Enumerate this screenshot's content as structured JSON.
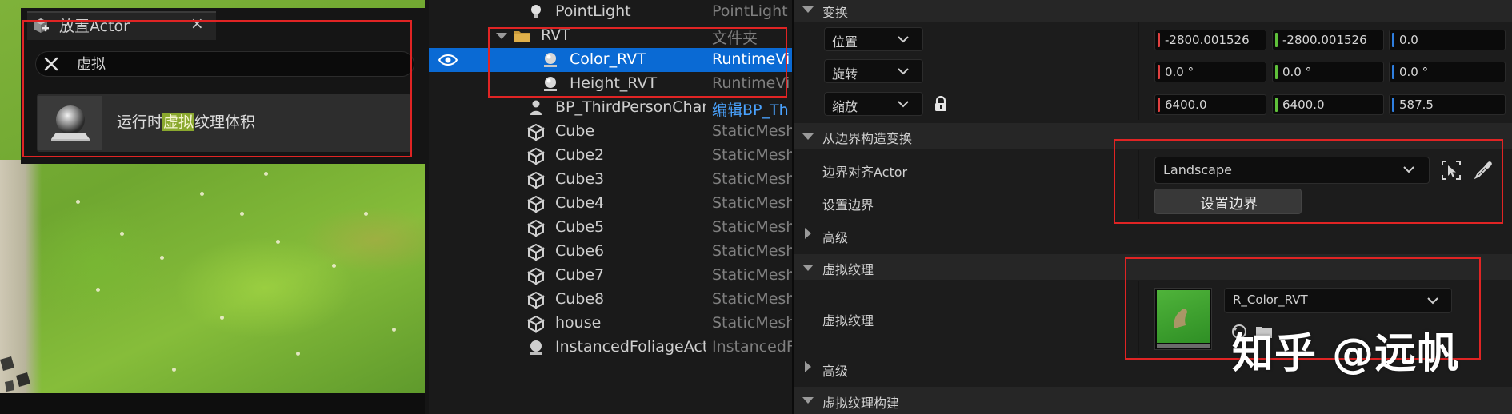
{
  "place_actor": {
    "tab_title": "放置Actor",
    "close_glyph": "×",
    "search_value": "虚拟",
    "result": {
      "pre": "运行时",
      "match": "虚拟",
      "post": "纹理体积"
    }
  },
  "outliner": {
    "rows": [
      {
        "name": "PointLight",
        "type": "PointLight",
        "icon": "point-light-icon"
      },
      {
        "name": "RVT",
        "type": "文件夹",
        "icon": "folder-icon"
      },
      {
        "name": "Color_RVT",
        "type": "RuntimeVi",
        "icon": "runtime-virtual-texture-icon",
        "selected": true
      },
      {
        "name": "Height_RVT",
        "type": "RuntimeVi",
        "icon": "runtime-virtual-texture-icon"
      },
      {
        "name": "BP_ThirdPersonChar",
        "type": "编辑BP_Th",
        "icon": "pawn-icon",
        "link": true
      },
      {
        "name": "Cube",
        "type": "StaticMesh",
        "icon": "static-mesh-icon"
      },
      {
        "name": "Cube2",
        "type": "StaticMesh",
        "icon": "static-mesh-icon"
      },
      {
        "name": "Cube3",
        "type": "StaticMesh",
        "icon": "static-mesh-icon"
      },
      {
        "name": "Cube4",
        "type": "StaticMesh",
        "icon": "static-mesh-icon"
      },
      {
        "name": "Cube5",
        "type": "StaticMesh",
        "icon": "static-mesh-icon"
      },
      {
        "name": "Cube6",
        "type": "StaticMesh",
        "icon": "static-mesh-icon"
      },
      {
        "name": "Cube7",
        "type": "StaticMesh",
        "icon": "static-mesh-icon"
      },
      {
        "name": "Cube8",
        "type": "StaticMesh",
        "icon": "static-mesh-icon"
      },
      {
        "name": "house",
        "type": "StaticMesh",
        "icon": "static-mesh-icon"
      },
      {
        "name": "InstancedFoliageActo",
        "type": "InstancedF",
        "icon": "foliage-icon"
      }
    ]
  },
  "details": {
    "transform": {
      "header": "变换",
      "location": {
        "label": "位置",
        "x": "-2800.001526",
        "y": "-2800.001526",
        "z": "0.0"
      },
      "rotation": {
        "label": "旋转",
        "x": "0.0 °",
        "y": "0.0 °",
        "z": "0.0 °"
      },
      "scale": {
        "label": "缩放",
        "x": "6400.0",
        "y": "6400.0",
        "z": "587.5"
      }
    },
    "bounds": {
      "header": "从边界构造变换",
      "align_label": "边界对齐Actor",
      "align_value": "Landscape",
      "set_label": "设置边界",
      "set_button": "设置边界",
      "advanced": "高级"
    },
    "vt": {
      "header": "虚拟纹理",
      "label": "虚拟纹理",
      "asset": "R_Color_RVT",
      "advanced": "高级"
    },
    "vt_build": {
      "header": "虚拟纹理构建"
    }
  },
  "watermark": "知乎 @远帆",
  "colors": {
    "selection": "#0a6ad4",
    "highlight_box": "#e02424",
    "axis_x": "#e04040",
    "axis_y": "#5fc03a",
    "axis_z": "#2f7fe0"
  }
}
